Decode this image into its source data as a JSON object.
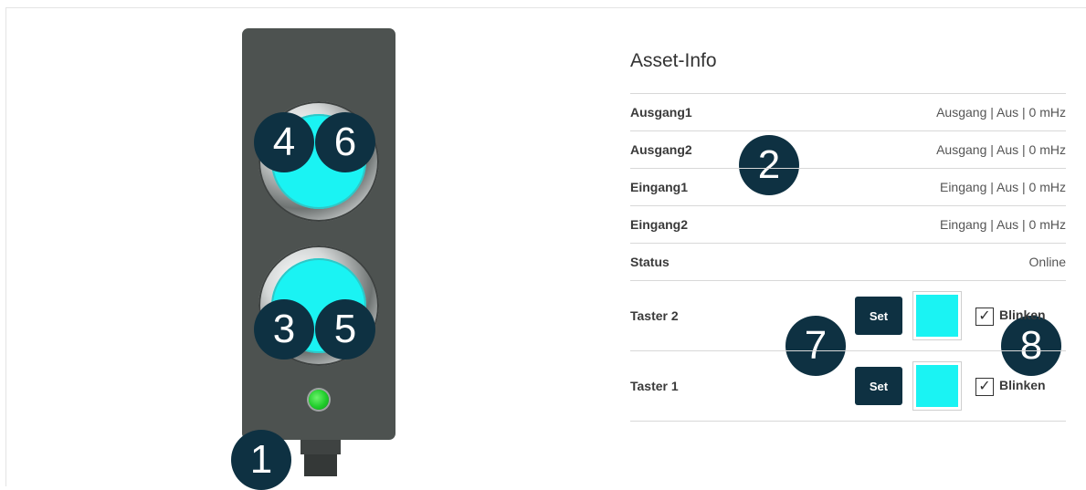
{
  "panel": {
    "title": "Asset-Info",
    "rows": [
      {
        "label": "Ausgang1",
        "value": "Ausgang | Aus | 0 mHz"
      },
      {
        "label": "Ausgang2",
        "value": "Ausgang | Aus | 0 mHz"
      },
      {
        "label": "Eingang1",
        "value": "Eingang | Aus | 0 mHz"
      },
      {
        "label": "Eingang2",
        "value": "Eingang | Aus | 0 mHz"
      },
      {
        "label": "Status",
        "value": "Online"
      }
    ],
    "controls": [
      {
        "label": "Taster 2",
        "set_label": "Set",
        "color": "#1af3f3",
        "checkbox_label": "Blinken",
        "checked": true,
        "check_mark": "✓"
      },
      {
        "label": "Taster 1",
        "set_label": "Set",
        "color": "#1af3f3",
        "checkbox_label": "Blinken",
        "checked": true,
        "check_mark": "✓"
      }
    ]
  },
  "device": {
    "button_color": "#1af3f3",
    "led_color": "#1fcc2a",
    "body_color": "#4d5250"
  },
  "callouts": {
    "c1": "1",
    "c2": "2",
    "c3": "3",
    "c4": "4",
    "c5": "5",
    "c6": "6",
    "c7": "7",
    "c8": "8"
  }
}
